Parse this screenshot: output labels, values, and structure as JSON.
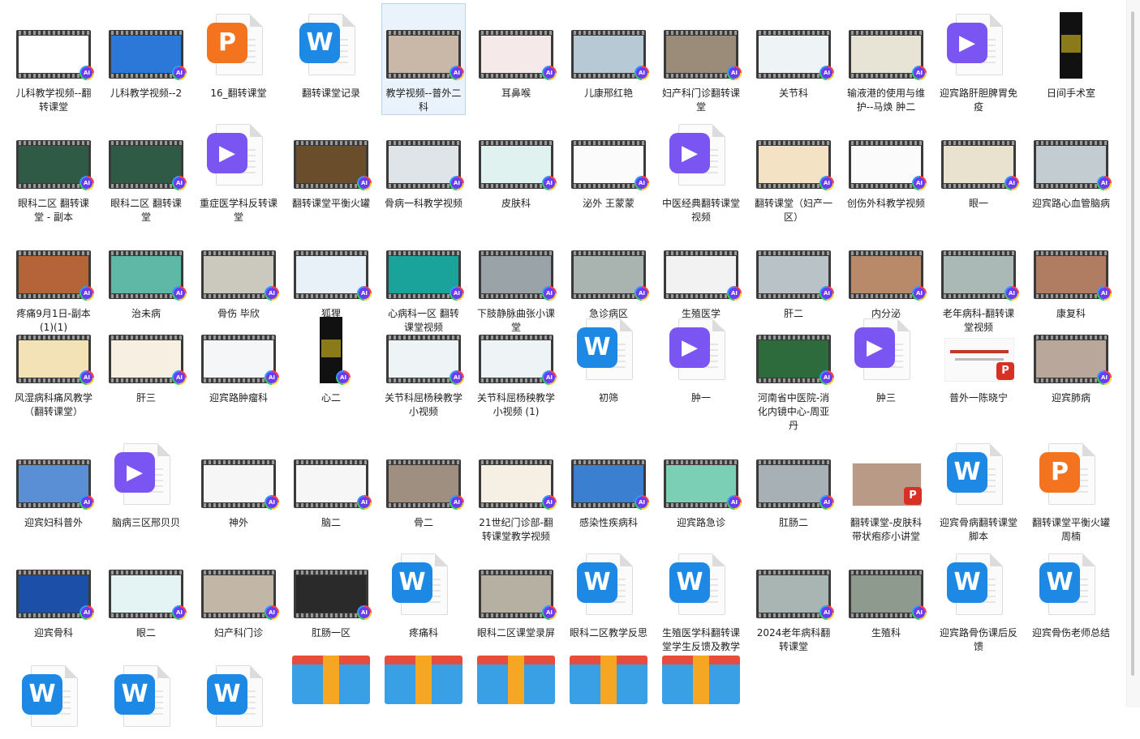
{
  "colors": {
    "selection": "#eaf2fb",
    "word": "#1e88e5",
    "ppt": "#f4731f",
    "video": "#7b55f2"
  },
  "files": [
    {
      "label": "儿科教学视频--翻转课堂",
      "type": "video",
      "screen": "#ffffff"
    },
    {
      "label": "儿科教学视频--2",
      "type": "video",
      "screen": "#2b78d8"
    },
    {
      "label": "16_翻转课堂",
      "type": "ppt"
    },
    {
      "label": "翻转课堂记录",
      "type": "word"
    },
    {
      "label": "教学视频--普外二科",
      "type": "video",
      "screen": "#c9b7a8",
      "selected": true
    },
    {
      "label": "耳鼻喉",
      "type": "video",
      "screen": "#f5e9e9"
    },
    {
      "label": "儿康邢红艳",
      "type": "video",
      "screen": "#b7c9d4"
    },
    {
      "label": "妇产科门诊翻转课堂",
      "type": "video",
      "screen": "#9b8c7a"
    },
    {
      "label": "关节科",
      "type": "video",
      "screen": "#eef3f6"
    },
    {
      "label": "输液港的使用与维护--马焕 肿二",
      "type": "video",
      "screen": "#e7e3d5"
    },
    {
      "label": "迎宾路肝胆脾胃免疫",
      "type": "play"
    },
    {
      "label": "日间手术室",
      "type": "vertical"
    },
    {
      "label": "眼科二区 翻转课堂 - 副本",
      "type": "video",
      "screen": "#2f5a46"
    },
    {
      "label": "眼科二区 翻转课堂",
      "type": "video",
      "screen": "#2f5a46"
    },
    {
      "label": "重症医学科反转课堂",
      "type": "play"
    },
    {
      "label": "翻转课堂平衡火罐",
      "type": "video",
      "screen": "#6a4e2c"
    },
    {
      "label": "骨病一科教学视频",
      "type": "video",
      "screen": "#dfe4e8"
    },
    {
      "label": "皮肤科",
      "type": "video",
      "screen": "#dff2ef"
    },
    {
      "label": "泌外 王蒙蒙",
      "type": "video",
      "screen": "#fbfbfb"
    },
    {
      "label": "中医经典翻转课堂视频",
      "type": "play"
    },
    {
      "label": "翻转课堂（妇产一区）",
      "type": "video",
      "screen": "#f3e2c4"
    },
    {
      "label": "创伤外科教学视频",
      "type": "video",
      "screen": "#fbfbfb"
    },
    {
      "label": "眼一",
      "type": "video",
      "screen": "#e9e2cf"
    },
    {
      "label": "迎宾路心血管脑病",
      "type": "video",
      "screen": "#c3ccd1"
    },
    {
      "label": "疼痛9月1日-副本(1)(1)",
      "type": "video",
      "screen": "#b5643a"
    },
    {
      "label": "治未病",
      "type": "video",
      "screen": "#5fb8a6"
    },
    {
      "label": "骨伤 毕欣",
      "type": "video",
      "screen": "#cbc8be"
    },
    {
      "label": "狐狸",
      "type": "video",
      "screen": "#e9f1f8"
    },
    {
      "label": "心病科一区 翻转课堂视频",
      "type": "video",
      "screen": "#1aa39a"
    },
    {
      "label": "下肢静脉曲张小课堂",
      "type": "video",
      "screen": "#9aa4a8"
    },
    {
      "label": "急诊病区",
      "type": "video",
      "screen": "#a9b3b0"
    },
    {
      "label": "生殖医学",
      "type": "video",
      "screen": "#f2f2f2"
    },
    {
      "label": "肝二",
      "type": "video",
      "screen": "#b9c3c7"
    },
    {
      "label": "内分泌",
      "type": "video",
      "screen": "#b98a6a"
    },
    {
      "label": "老年病科-翻转课堂视频",
      "type": "video",
      "screen": "#aab8b6"
    },
    {
      "label": "康复科",
      "type": "video",
      "screen": "#b07c62"
    },
    {
      "label": "风湿病科痛风教学（翻转课堂）",
      "type": "video",
      "screen": "#f2e2b6"
    },
    {
      "label": "肝三",
      "type": "video",
      "screen": "#f6efe2"
    },
    {
      "label": "迎宾路肿瘤科",
      "type": "video",
      "screen": "#f4f6f8"
    },
    {
      "label": "心二",
      "type": "vertical"
    },
    {
      "label": "关节科屈杨秧教学小视频",
      "type": "video",
      "screen": "#eef3f6"
    },
    {
      "label": "关节科屈杨秧教学小视频 (1)",
      "type": "video",
      "screen": "#eef3f6"
    },
    {
      "label": "初筛",
      "type": "word"
    },
    {
      "label": "肿一",
      "type": "play"
    },
    {
      "label": "河南省中医院-消化内镜中心-周亚丹",
      "type": "video",
      "screen": "#2e6b3c"
    },
    {
      "label": "肿三",
      "type": "play"
    },
    {
      "label": "普外一陈晓宁",
      "type": "slide"
    },
    {
      "label": "迎宾肺病",
      "type": "video",
      "screen": "#b8a79a"
    },
    {
      "label": "迎宾妇科普外",
      "type": "video",
      "screen": "#5a8fd6"
    },
    {
      "label": "脑病三区邢贝贝",
      "type": "play"
    },
    {
      "label": "神外",
      "type": "video",
      "screen": "#f6f6f6"
    },
    {
      "label": "脑二",
      "type": "video",
      "screen": "#f6f6f6"
    },
    {
      "label": "骨二",
      "type": "video",
      "screen": "#9e8f80"
    },
    {
      "label": "21世纪门诊部-翻转课堂教学视频",
      "type": "video",
      "screen": "#f5efe4"
    },
    {
      "label": "感染性疾病科",
      "type": "video",
      "screen": "#3a7fd0"
    },
    {
      "label": "迎宾路急诊",
      "type": "video",
      "screen": "#7bcfb4"
    },
    {
      "label": "肛肠二",
      "type": "video",
      "screen": "#a7b1b5"
    },
    {
      "label": "翻转课堂-皮肤科带状疱疹小讲堂",
      "type": "photo"
    },
    {
      "label": "迎宾骨病翻转课堂脚本",
      "type": "word"
    },
    {
      "label": "翻转课堂平衡火罐周楠",
      "type": "ppt"
    },
    {
      "label": "迎宾骨科",
      "type": "video",
      "screen": "#1c4fa8"
    },
    {
      "label": "眼二",
      "type": "video",
      "screen": "#e4f3f4"
    },
    {
      "label": "妇产科门诊",
      "type": "video",
      "screen": "#c2b7a7"
    },
    {
      "label": "肛肠一区",
      "type": "video",
      "screen": "#2a2a2a"
    },
    {
      "label": "疼痛科",
      "type": "word"
    },
    {
      "label": "眼科二区课堂录屏",
      "type": "video",
      "screen": "#b6b0a2"
    },
    {
      "label": "眼科二区教学反思",
      "type": "word"
    },
    {
      "label": "生殖医学科翻转课堂学生反馈及教学反思",
      "type": "word"
    },
    {
      "label": "2024老年病科翻转课堂",
      "type": "video",
      "screen": "#a9b5b3"
    },
    {
      "label": "生殖科",
      "type": "video",
      "screen": "#8f9a8e"
    },
    {
      "label": "迎宾路骨伤课后反馈",
      "type": "word"
    },
    {
      "label": "迎宾骨伤老师总结",
      "type": "word"
    },
    {
      "label": "",
      "type": "word"
    },
    {
      "label": "",
      "type": "word"
    },
    {
      "label": "",
      "type": "word"
    },
    {
      "label": "",
      "type": "zip"
    },
    {
      "label": "",
      "type": "zip"
    },
    {
      "label": "",
      "type": "zip"
    },
    {
      "label": "",
      "type": "zip"
    },
    {
      "label": "",
      "type": "zip"
    }
  ]
}
